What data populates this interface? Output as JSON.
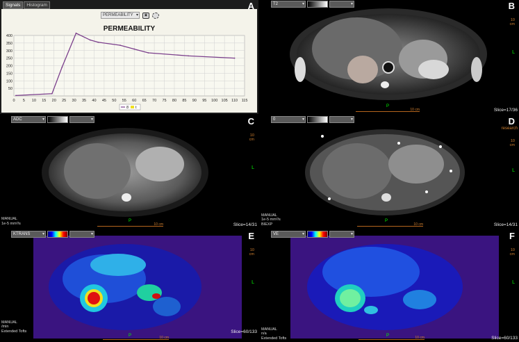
{
  "panelA": {
    "letter": "A",
    "tabs": [
      "Signals",
      "Histogram"
    ],
    "select_value": "PERMEABILITY",
    "chart_data": {
      "type": "line",
      "title": "PERMEABILITY",
      "xlabel": "",
      "ylabel": "",
      "xlim": [
        0,
        115
      ],
      "ylim": [
        0,
        400
      ],
      "xticks": [
        0,
        5,
        10,
        15,
        20,
        25,
        30,
        35,
        40,
        45,
        50,
        55,
        60,
        65,
        70,
        75,
        80,
        85,
        90,
        95,
        100,
        105,
        110,
        115
      ],
      "yticks": [
        50,
        100,
        150,
        200,
        250,
        300,
        350,
        400
      ],
      "grid": true,
      "legend": {
        "position": "bottom-center",
        "entries": [
          "8",
          "t"
        ]
      },
      "series": [
        {
          "name": "8",
          "color": "#7b3f8c",
          "x": [
            1,
            19,
            24,
            31,
            38,
            42,
            53,
            60,
            67,
            87,
            110
          ],
          "y": [
            3,
            15,
            190,
            415,
            370,
            355,
            335,
            310,
            285,
            265,
            250
          ]
        }
      ]
    }
  },
  "panelB": {
    "letter": "B",
    "sequence": "T2",
    "slice": "Slice=17/36",
    "p_mark": "P",
    "l_mark": "L",
    "scale_label": "10 cm",
    "vscale": [
      "10",
      "cm"
    ]
  },
  "panelC": {
    "letter": "C",
    "sequence": "ADC",
    "info": [
      "MANUAL",
      "1e-5 mm²/s"
    ],
    "slice": "Slice=14/31",
    "p_mark": "P",
    "l_mark": "L",
    "scale_label": "10 cm",
    "vscale": [
      "10",
      "cm"
    ]
  },
  "panelD": {
    "letter": "D",
    "sequence": "0",
    "research": "research",
    "info": [
      "MANUAL",
      "1e-5 mm²/s",
      "BIEXP"
    ],
    "slice": "Slice=14/31",
    "p_mark": "P",
    "l_mark": "L",
    "scale_label": "10 cm",
    "vscale": [
      "10",
      "cm"
    ]
  },
  "panelE": {
    "letter": "E",
    "sequence": "KTRANS",
    "info": [
      "MANUAL",
      "/min",
      "Extended Tofts"
    ],
    "slice": "Slice=60/133",
    "p_mark": "P",
    "l_mark": "L",
    "scale_label": "10 cm",
    "vscale": [
      "10",
      "cm"
    ]
  },
  "panelF": {
    "letter": "F",
    "sequence": "VE",
    "info": [
      "MANUAL",
      "n/a",
      "Extended Tofts"
    ],
    "slice": "Slice=60/133",
    "p_mark": "P",
    "l_mark": "L",
    "scale_label": "10 cm",
    "vscale": [
      "10",
      "cm"
    ]
  }
}
